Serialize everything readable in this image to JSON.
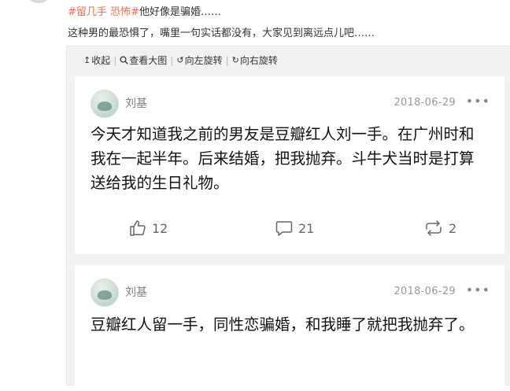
{
  "post": {
    "tags": [
      "#留几手",
      "恐怖#"
    ],
    "tag_suffix": "他好像是骗婚……",
    "caption": "这种男的最恐惧了，嘴里一句实话都没有，大家见到离远点儿吧……"
  },
  "toolbar": {
    "collapse_label": "收起",
    "view_large_label": "查看大图",
    "rotate_left_label": "向左旋转",
    "rotate_right_label": "向右旋转"
  },
  "cards": [
    {
      "author": "刘基",
      "date": "2018-06-29",
      "more": "•••",
      "text": "今天才知道我之前的男友是豆瓣红人刘一手。在广州时和我在一起半年。后来结婚，把我抛弃。斗牛犬当时是打算送给我的生日礼物。",
      "likes": "12",
      "comments": "21",
      "reposts": "2"
    },
    {
      "author": "刘基",
      "date": "2018-06-29",
      "more": "•••",
      "text": "豆瓣红人留一手，同性恋骗婚，和我睡了就把我抛弃了。"
    }
  ],
  "icons": {
    "collapse": "↥",
    "search": "🔍",
    "rotate_left": "↺",
    "rotate_right": "↻"
  },
  "colors": {
    "tag": "#eb7350",
    "panel_bg": "#f2f2f5",
    "card_bg": "#ffffff",
    "meta_text": "#999999"
  }
}
